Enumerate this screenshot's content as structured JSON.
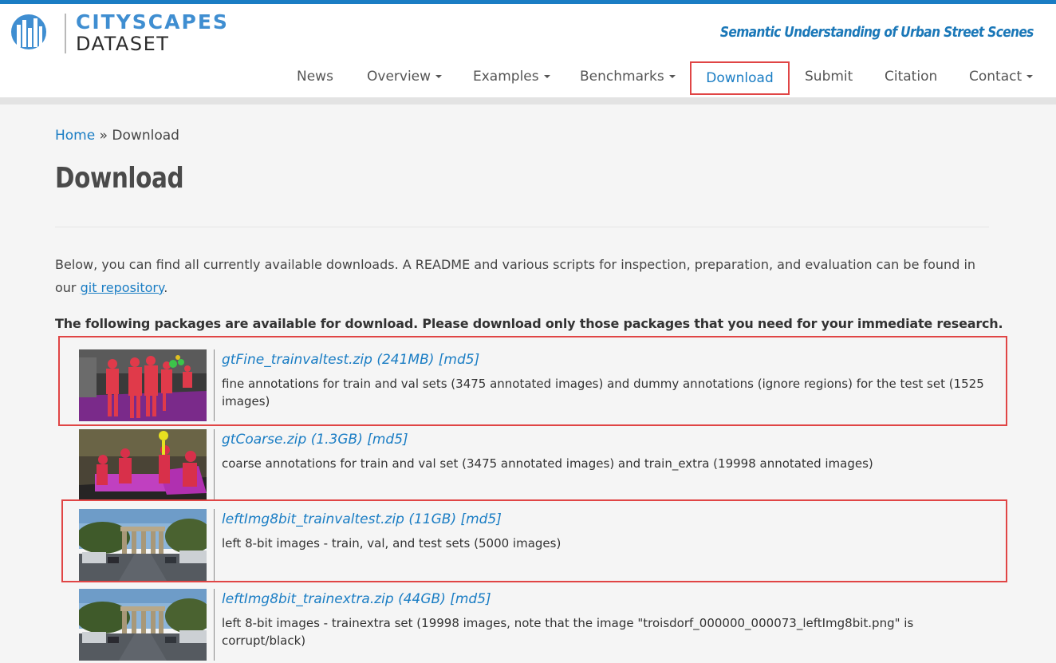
{
  "brand": {
    "line1": "CITYSCAPES",
    "line2": "DATASET",
    "tagline": "Semantic Understanding of Urban Street Scenes",
    "logo_icon": "city-skyline-logo-icon",
    "brand_color": "#3f8ed1"
  },
  "nav": {
    "items": [
      {
        "label": "News",
        "dropdown": false
      },
      {
        "label": "Overview",
        "dropdown": true
      },
      {
        "label": "Examples",
        "dropdown": true
      },
      {
        "label": "Benchmarks",
        "dropdown": true
      },
      {
        "label": "Download",
        "dropdown": false,
        "active": true
      },
      {
        "label": "Submit",
        "dropdown": false
      },
      {
        "label": "Citation",
        "dropdown": false
      },
      {
        "label": "Contact",
        "dropdown": true
      }
    ]
  },
  "breadcrumb": {
    "home": "Home",
    "separator": " » ",
    "current": "Download"
  },
  "page": {
    "title": "Download",
    "intro_before": "Below, you can find all currently available downloads. A README and various scripts for inspection, preparation, and evaluation can be found in our ",
    "intro_link": "git repository",
    "intro_after": ".",
    "packages_heading": "The following packages are available for download. Please download only those packages that you need for your immediate research."
  },
  "packages": [
    {
      "link": "gtFine_trainvaltest.zip (241MB) [md5]",
      "description": "fine annotations for train and val sets (3475 annotated images) and dummy annotations (ignore regions) for the test set (1525 images)",
      "thumb": "fine-annotation-thumbnail"
    },
    {
      "link": "gtCoarse.zip (1.3GB) [md5]",
      "description": "coarse annotations for train and val set (3475 annotated images) and train_extra (19998 annotated images)",
      "thumb": "coarse-annotation-thumbnail"
    },
    {
      "link": "leftImg8bit_trainvaltest.zip (11GB) [md5]",
      "description": "left 8-bit images - train, val, and test sets (5000 images)",
      "thumb": "street-photo-thumbnail"
    },
    {
      "link": "leftImg8bit_trainextra.zip (44GB) [md5]",
      "description": "left 8-bit images - trainextra set (19998 images, note that the image \"troisdorf_000000_000073_leftImg8bit.png\" is corrupt/black)",
      "thumb": "street-photo-thumbnail"
    }
  ],
  "colors": {
    "accent": "#1a7dc4",
    "highlight": "#e04545"
  }
}
